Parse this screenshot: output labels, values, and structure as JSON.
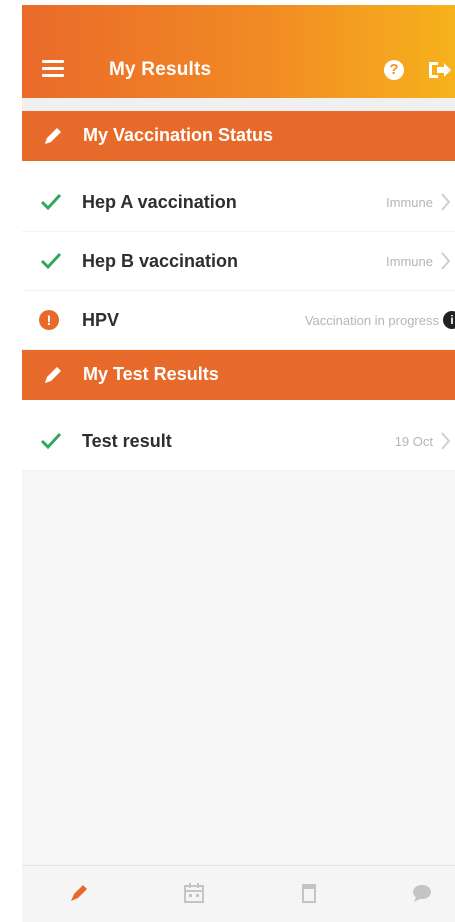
{
  "header": {
    "title": "My Results",
    "help_glyph": "?",
    "icons": [
      "menu-icon",
      "help-icon",
      "logout-icon"
    ],
    "gradient": [
      "#ea6a2a",
      "#f6b21c"
    ]
  },
  "sections": [
    {
      "title": "My Vaccination Status",
      "icon": "pencil-icon",
      "items": [
        {
          "name": "Hep A vaccination",
          "value": "Immune",
          "status": "check"
        },
        {
          "name": "Hep B vaccination",
          "value": "Immune",
          "status": "check"
        },
        {
          "name": "HPV",
          "value": "Vaccination in progress",
          "status": "warning",
          "status_glyph": "!",
          "trailing_glyph": "i"
        }
      ]
    },
    {
      "title": "My Test Results",
      "icon": "pencil-icon",
      "items": [
        {
          "name": "Test result",
          "value": "19 Oct",
          "status": "check"
        }
      ]
    }
  ],
  "tabbar": {
    "tabs": [
      "results-icon",
      "calendar-icon",
      "trash-icon",
      "chat-icon"
    ],
    "active": "results-icon"
  },
  "colors": {
    "accent": "#e86a2b",
    "check": "#2eaa5a",
    "muted": "#b5b5b5"
  }
}
